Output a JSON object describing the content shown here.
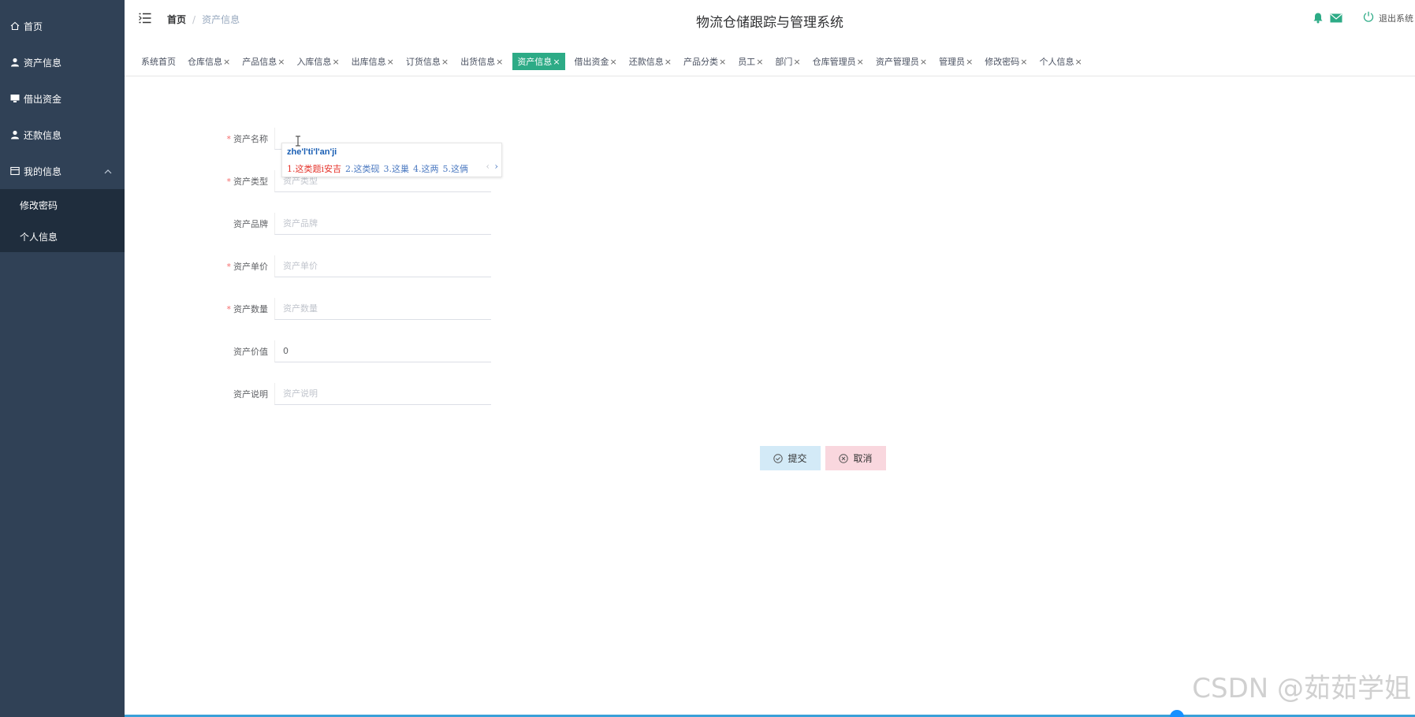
{
  "sidebar": {
    "items": [
      {
        "label": "首页",
        "icon": "home-icon"
      },
      {
        "label": "资产信息",
        "icon": "user-icon"
      },
      {
        "label": "借出资金",
        "icon": "monitor-icon"
      },
      {
        "label": "还款信息",
        "icon": "user-icon"
      },
      {
        "label": "我的信息",
        "icon": "card-icon"
      }
    ],
    "submenu": [
      "修改密码",
      "个人信息"
    ]
  },
  "header": {
    "breadcrumb": {
      "home": "首页",
      "current": "资产信息"
    },
    "title": "物流仓储跟踪与管理系统",
    "logout": "退出系统",
    "accent": "#2dab86"
  },
  "tags": [
    {
      "label": "系统首页",
      "closable": false
    },
    {
      "label": "仓库信息",
      "closable": true
    },
    {
      "label": "产品信息",
      "closable": true
    },
    {
      "label": "入库信息",
      "closable": true
    },
    {
      "label": "出库信息",
      "closable": true
    },
    {
      "label": "订货信息",
      "closable": true
    },
    {
      "label": "出货信息",
      "closable": true
    },
    {
      "label": "资产信息",
      "closable": true,
      "active": true
    },
    {
      "label": "借出资金",
      "closable": true
    },
    {
      "label": "还款信息",
      "closable": true
    },
    {
      "label": "产品分类",
      "closable": true
    },
    {
      "label": "员工",
      "closable": true
    },
    {
      "label": "部门",
      "closable": true
    },
    {
      "label": "仓库管理员",
      "closable": true
    },
    {
      "label": "资产管理员",
      "closable": true
    },
    {
      "label": "管理员",
      "closable": true
    },
    {
      "label": "修改密码",
      "closable": true
    },
    {
      "label": "个人信息",
      "closable": true
    }
  ],
  "tag_close": "×",
  "form": {
    "fields": [
      {
        "label": "资产名称",
        "required": true,
        "placeholder": "",
        "value": ""
      },
      {
        "label": "资产类型",
        "required": true,
        "placeholder": "资产类型",
        "value": ""
      },
      {
        "label": "资产品牌",
        "required": false,
        "placeholder": "资产品牌",
        "value": ""
      },
      {
        "label": "资产单价",
        "required": true,
        "placeholder": "资产单价",
        "value": ""
      },
      {
        "label": "资产数量",
        "required": true,
        "placeholder": "资产数量",
        "value": ""
      },
      {
        "label": "资产价值",
        "required": false,
        "placeholder": "",
        "value": "0"
      },
      {
        "label": "资产说明",
        "required": false,
        "placeholder": "资产说明",
        "value": ""
      }
    ],
    "required_mark": "*",
    "submit": "提交",
    "cancel": "取消"
  },
  "ime": {
    "pinyin": "zhe'l'ti'l'an'ji",
    "candidates": [
      "1.这类题i安吉",
      "2.这类砚",
      "3.这巢",
      "4.这两",
      "5.这俩"
    ],
    "prev": "‹",
    "next": "›"
  },
  "watermark": "CSDN @茹茹学姐"
}
